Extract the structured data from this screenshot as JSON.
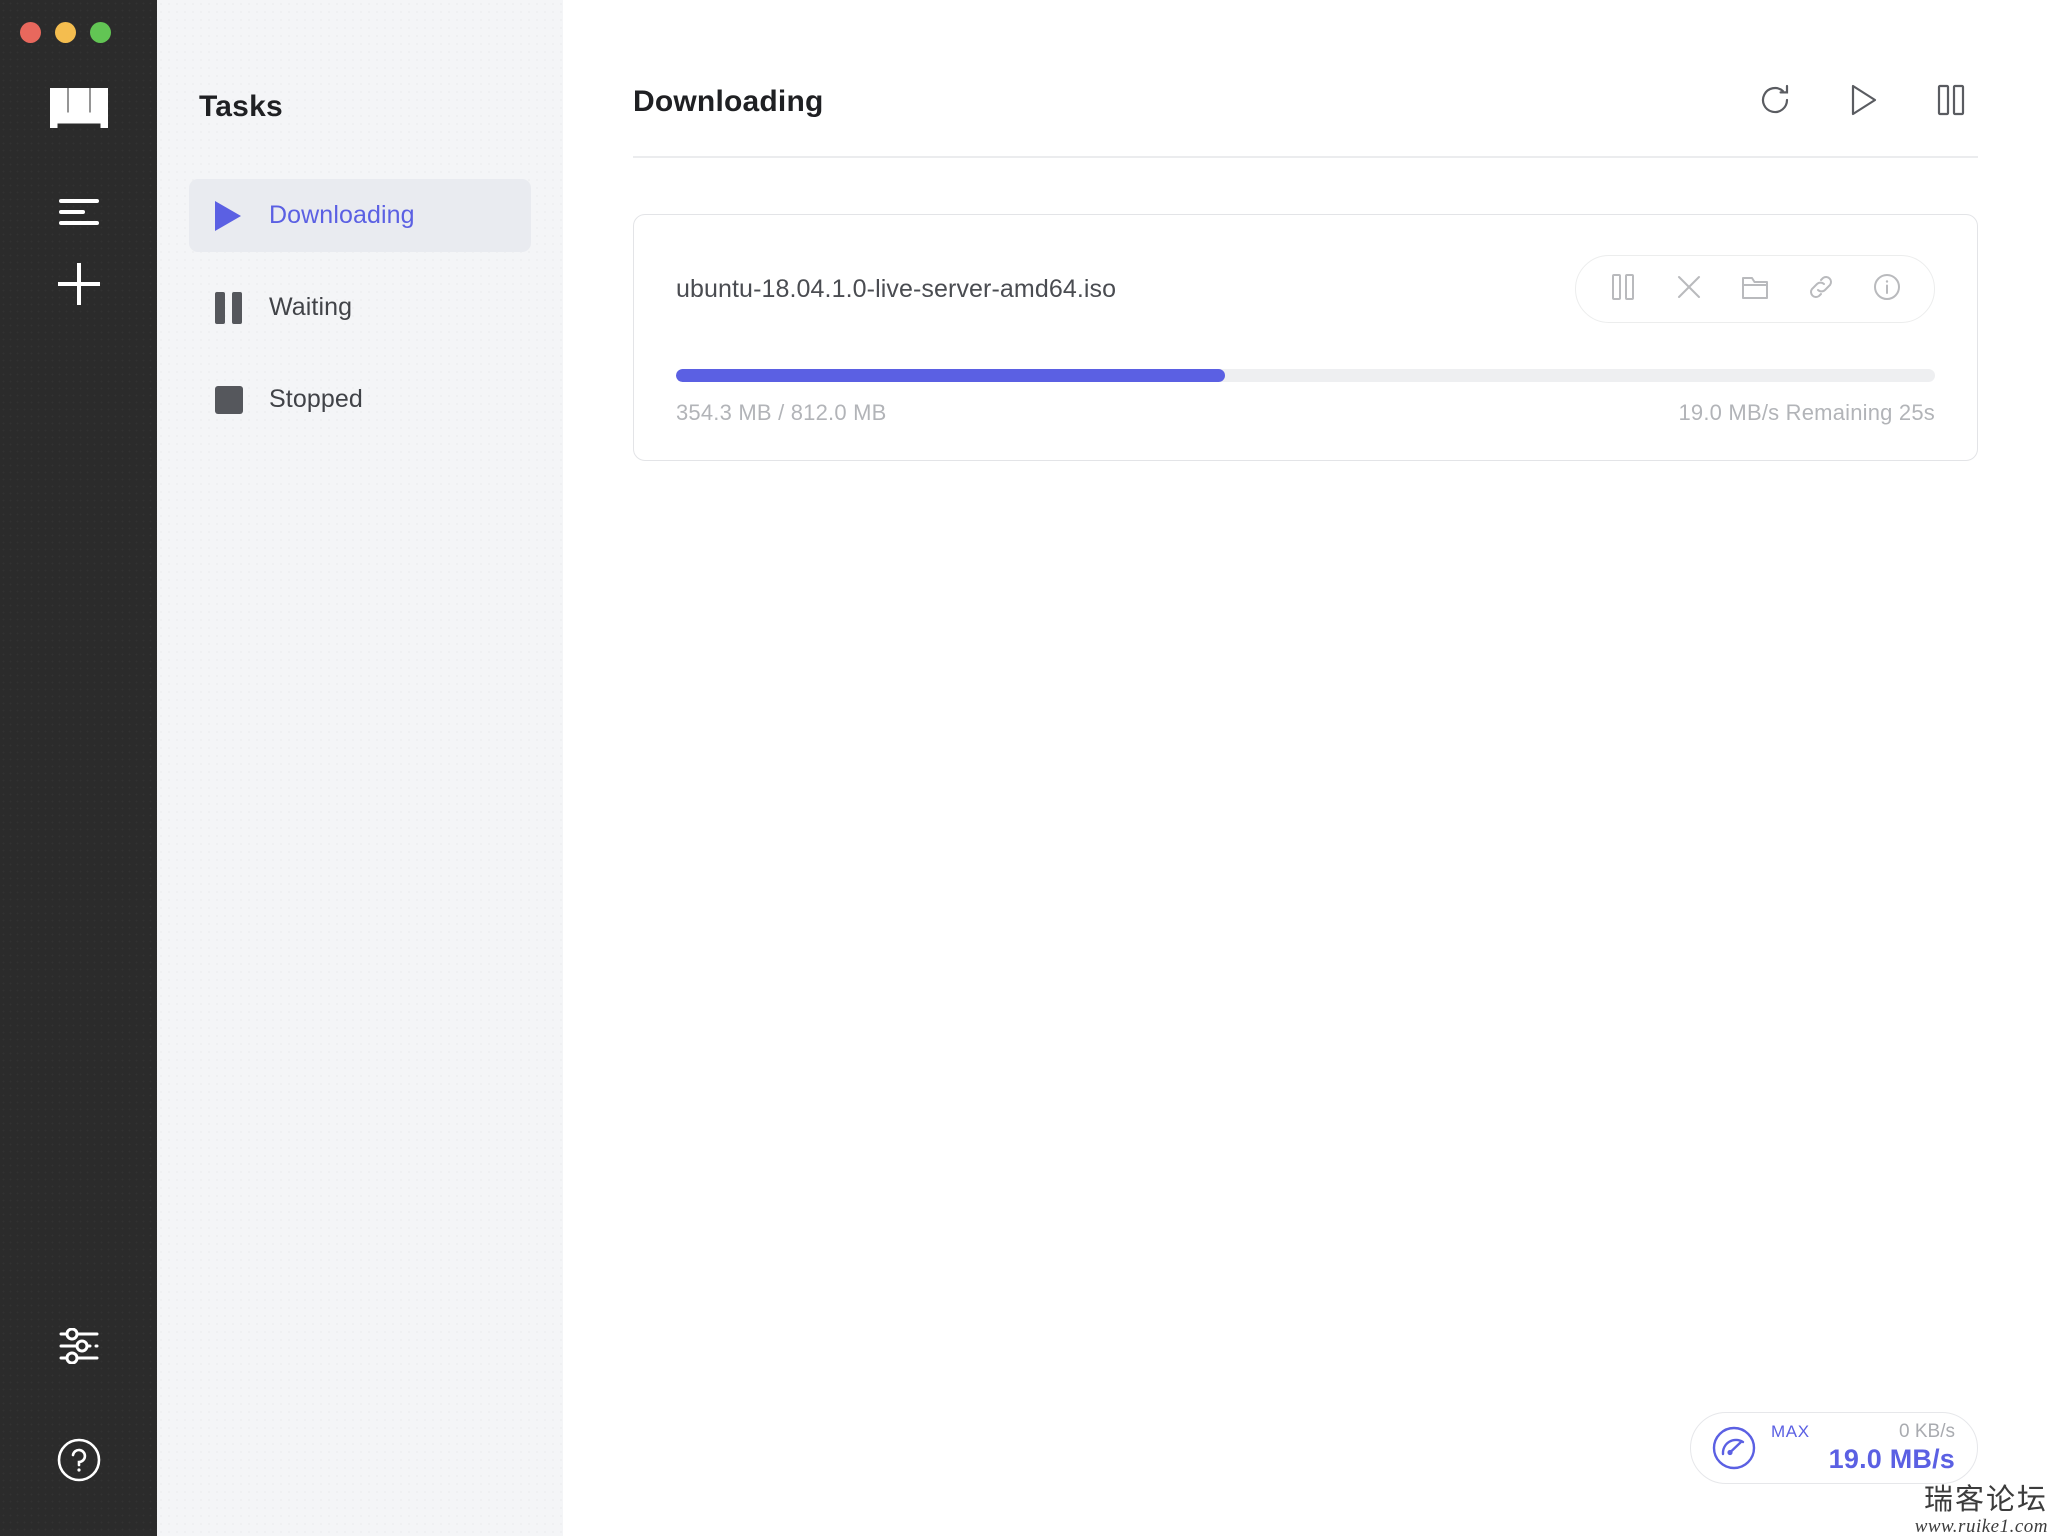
{
  "window": {
    "traffic_lights": [
      {
        "name": "close",
        "color": "#e8685d"
      },
      {
        "name": "minimize",
        "color": "#f4bd4f"
      },
      {
        "name": "zoom",
        "color": "#62c554"
      }
    ]
  },
  "rail": {
    "logo": "m",
    "items": [
      {
        "icon": "task-list-icon",
        "name": "task-list"
      },
      {
        "icon": "plus-icon",
        "name": "add-task"
      }
    ],
    "bottom_items": [
      {
        "icon": "sliders-icon",
        "name": "preferences"
      },
      {
        "icon": "question-circle-icon",
        "name": "help"
      }
    ]
  },
  "panel": {
    "title": "Tasks",
    "items": [
      {
        "label": "Downloading",
        "icon": "play-icon",
        "active": true
      },
      {
        "label": "Waiting",
        "icon": "pause-icon",
        "active": false
      },
      {
        "label": "Stopped",
        "icon": "stop-square-icon",
        "active": false
      }
    ]
  },
  "main": {
    "title": "Downloading",
    "header_actions": [
      {
        "name": "refresh-button",
        "icon": "refresh-icon"
      },
      {
        "name": "resume-all-button",
        "icon": "play-outline-icon"
      },
      {
        "name": "pause-all-button",
        "icon": "pause-outline-icon"
      }
    ],
    "tasks": [
      {
        "file_name": "ubuntu-18.04.1.0-live-server-amd64.iso",
        "progress_percent": 43.6,
        "progress_text": "354.3 MB / 812.0 MB",
        "status_text": "19.0 MB/s Remaining 25s",
        "tools": [
          {
            "name": "pause-task-button",
            "icon": "pause-outline-icon"
          },
          {
            "name": "delete-task-button",
            "icon": "close-icon"
          },
          {
            "name": "open-folder-button",
            "icon": "folder-icon"
          },
          {
            "name": "copy-link-button",
            "icon": "link-icon"
          },
          {
            "name": "task-info-button",
            "icon": "info-circle-icon"
          }
        ]
      }
    ]
  },
  "speed_widget": {
    "icon": "speedometer-icon",
    "max_label": "MAX",
    "upload_speed": "0 KB/s",
    "download_speed": "19.0 MB/s"
  },
  "watermark": {
    "text_cn": "瑞客论坛",
    "text_url": "www.ruike1.com"
  },
  "colors": {
    "accent": "#5b60e3",
    "rail_bg": "#2b2b2b",
    "panel_bg": "#f4f5f7",
    "muted_text": "#b2b4b8"
  }
}
